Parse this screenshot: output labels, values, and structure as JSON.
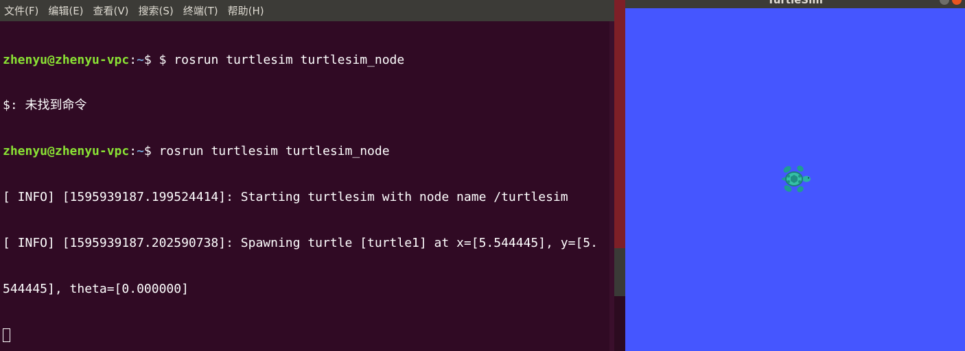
{
  "terminal": {
    "menu": [
      "文件(F)",
      "编辑(E)",
      "查看(V)",
      "搜索(S)",
      "终端(T)",
      "帮助(H)"
    ],
    "lines": [
      {
        "type": "prompt",
        "user": "zhenyu@zhenyu-vpc",
        "sep": ":",
        "path": "~",
        "cmd": "$ $ rosrun turtlesim turtlesim_node"
      },
      {
        "type": "text",
        "text": "$: 未找到命令"
      },
      {
        "type": "prompt",
        "user": "zhenyu@zhenyu-vpc",
        "sep": ":",
        "path": "~",
        "cmd": "$ rosrun turtlesim turtlesim_node"
      },
      {
        "type": "text",
        "text": "[ INFO] [1595939187.199524414]: Starting turtlesim with node name /turtlesim"
      },
      {
        "type": "text",
        "text": "[ INFO] [1595939187.202590738]: Spawning turtle [turtle1] at x=[5.544445], y=[5."
      },
      {
        "type": "text",
        "text": "544445], theta=[0.000000]"
      }
    ]
  },
  "turtlesim": {
    "title": "TurtleSim",
    "background_color": "#4556ff",
    "turtle_icon": "turtle-icon"
  },
  "colors": {
    "terminal_bg": "#300a24",
    "prompt_user": "#8ae234",
    "prompt_path": "#729fcf",
    "menubar_bg": "#3c3b37"
  }
}
